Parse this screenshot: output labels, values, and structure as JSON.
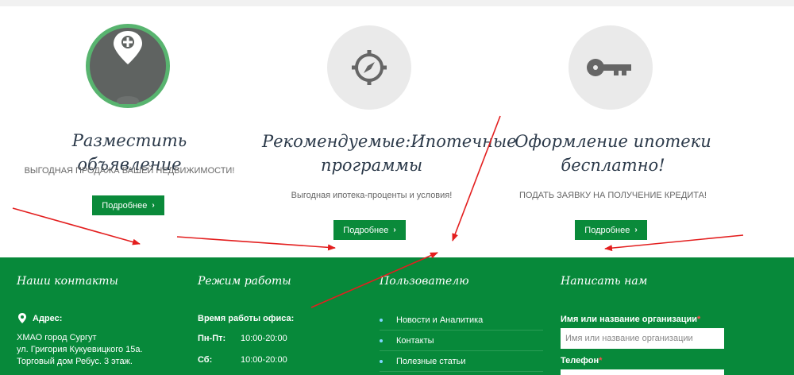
{
  "features": [
    {
      "title": "Разместить объявление",
      "subtitle": "ВЫГОДНАЯ ПРОДАЖА ВАШЕЙ НЕДВИЖИМОСТИ!",
      "button": "Подробнее",
      "icon": "map-pin-plus-icon"
    },
    {
      "title": "Рекомендуемые:Ипотечные программы",
      "subtitle": "Выгодная ипотека-проценты и условия!",
      "button": "Подробнее",
      "icon": "compass-icon"
    },
    {
      "title": "Оформление ипотеки бесплатно!",
      "subtitle": "ПОДАТЬ ЗАЯВКУ НА ПОЛУЧЕНИЕ КРЕДИТА!",
      "button": "Подробнее",
      "icon": "key-icon"
    }
  ],
  "footer": {
    "contacts": {
      "heading": "Наши контакты",
      "address_label": "Адрес:",
      "address_lines": [
        "ХМАО город Сургут",
        "ул. Григория Кукуевицкого 15а.",
        "Торговый дом Ребус. 3 этаж."
      ]
    },
    "hours": {
      "heading": "Режим работы",
      "title": "Время работы офиса:",
      "rows": [
        {
          "day": "Пн-Пт:",
          "time": "10:00-20:00"
        },
        {
          "day": "Сб:",
          "time": "10:00-20:00"
        }
      ]
    },
    "users": {
      "heading": "Пользователю",
      "links": [
        "Новости и Аналитика",
        "Контакты",
        "Полезные статьи"
      ]
    },
    "write": {
      "heading": "Написать нам",
      "org_label": "Имя или название организации",
      "required_mark": "*",
      "org_placeholder": "Имя или название организации",
      "phone_label": "Телефон"
    }
  },
  "colors": {
    "brand_green": "#07893a",
    "button_green": "#0a8a3a",
    "arrow_red": "#e31e1e"
  }
}
